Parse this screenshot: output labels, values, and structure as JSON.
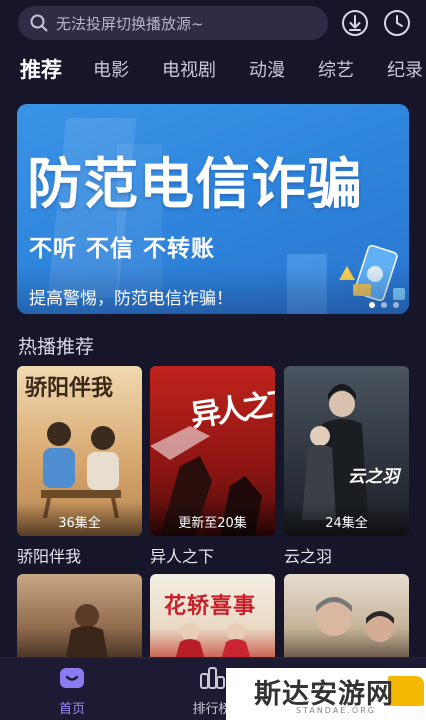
{
  "search": {
    "placeholder": "无法投屏切换播放源~"
  },
  "header_icons": [
    "download-icon",
    "history-icon"
  ],
  "tabs": [
    {
      "label": "推荐",
      "active": true
    },
    {
      "label": "电影",
      "active": false
    },
    {
      "label": "电视剧",
      "active": false
    },
    {
      "label": "动漫",
      "active": false
    },
    {
      "label": "综艺",
      "active": false
    },
    {
      "label": "纪录",
      "active": false
    }
  ],
  "banner": {
    "title": "防范电信诈骗",
    "slogan": "不听 不信 不转账",
    "caption": "提高警惕，防范电信诈骗！",
    "page_count": 3,
    "current_page": 1
  },
  "section": {
    "title": "热播推荐"
  },
  "cards": [
    {
      "title": "骄阳伴我",
      "badge": "36集全",
      "poster_text": "骄阳伴我"
    },
    {
      "title": "异人之下",
      "badge": "更新至20集",
      "poster_text": "异人之下"
    },
    {
      "title": "云之羽",
      "badge": "24集全",
      "poster_text": "云之羽"
    }
  ],
  "cards_row2": [
    {
      "poster_text": ""
    },
    {
      "poster_text": "花轿喜事"
    },
    {
      "poster_text": ""
    }
  ],
  "bottom_nav": [
    {
      "label": "首页",
      "icon": "home-icon",
      "active": true
    },
    {
      "label": "排行榜",
      "icon": "ranking-icon",
      "active": false
    }
  ],
  "watermark": {
    "text": "斯达安游网",
    "subtext": "STANDAE.ORG"
  },
  "colors": {
    "background": "#16152a",
    "accent": "#8a7cf0",
    "banner_blue": "#3390e3",
    "nav_active": "#9d8cf5"
  }
}
